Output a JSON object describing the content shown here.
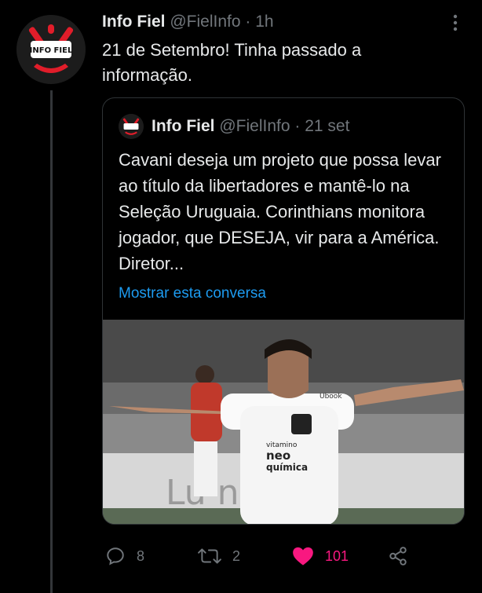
{
  "tweet": {
    "name": "Info Fiel",
    "handle": "@FielInfo",
    "separator": "·",
    "time": "1h",
    "text": "21 de Setembro! Tinha passado a informação.",
    "avatar_text": "INFO FIEL"
  },
  "quote": {
    "name": "Info Fiel",
    "handle": "@FielInfo",
    "separator": "·",
    "date": "21 set",
    "text": "Cavani deseja um projeto que possa levar ao título da libertadores e mantê-lo na Seleção Uruguaia. Corinthians monitora jogador, que DESEJA, vir para a América. Diretor...",
    "show_thread_link": "Mostrar esta conversa",
    "image_text": {
      "sponsor_line1": "vitamino",
      "sponsor_line2": "neo",
      "sponsor_line3": "química",
      "shirt_brand": "Ubook",
      "board_text": "Lu  na"
    }
  },
  "actions": {
    "replies": "8",
    "retweets": "2",
    "likes": "101"
  },
  "colors": {
    "background": "#000000",
    "text": "#e7e9ea",
    "muted": "#71767b",
    "link": "#1d9bf0",
    "like": "#f91880"
  },
  "icons": [
    "more-icon",
    "reply-icon",
    "retweet-icon",
    "like-icon",
    "share-icon"
  ]
}
